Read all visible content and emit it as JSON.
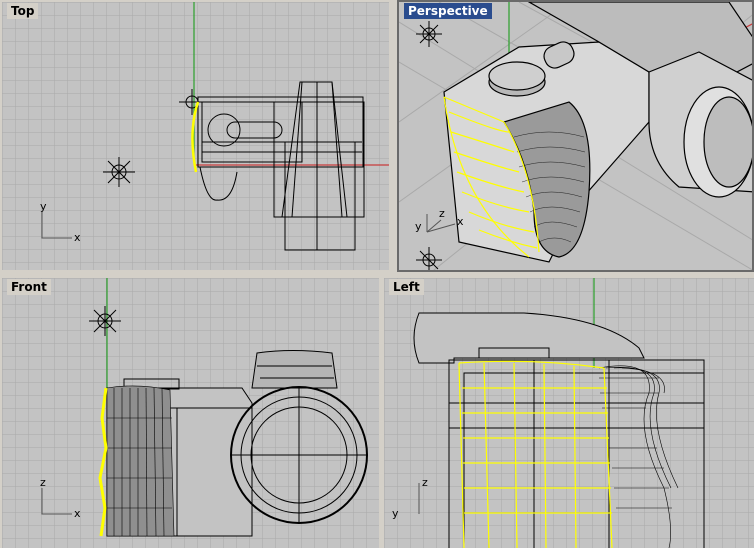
{
  "viewports": {
    "top": {
      "title": "Top",
      "axes": [
        "x",
        "y"
      ]
    },
    "perspective": {
      "title": "Perspective",
      "axes": [
        "x",
        "y",
        "z"
      ]
    },
    "front": {
      "title": "Front",
      "axes": [
        "x",
        "z"
      ]
    },
    "left": {
      "title": "Left",
      "axes": [
        "y",
        "z"
      ]
    }
  },
  "colors": {
    "background": "#c3c3c3",
    "grid": "#a9a9a9",
    "grid_axis_x": "#c83c3c",
    "grid_axis_y": "#2ca02c",
    "selection": "#ffff00",
    "wire": "#000000",
    "active_tab": "#2a4c8e"
  },
  "icons": [
    "light-icon",
    "axis-gizmo-icon"
  ]
}
